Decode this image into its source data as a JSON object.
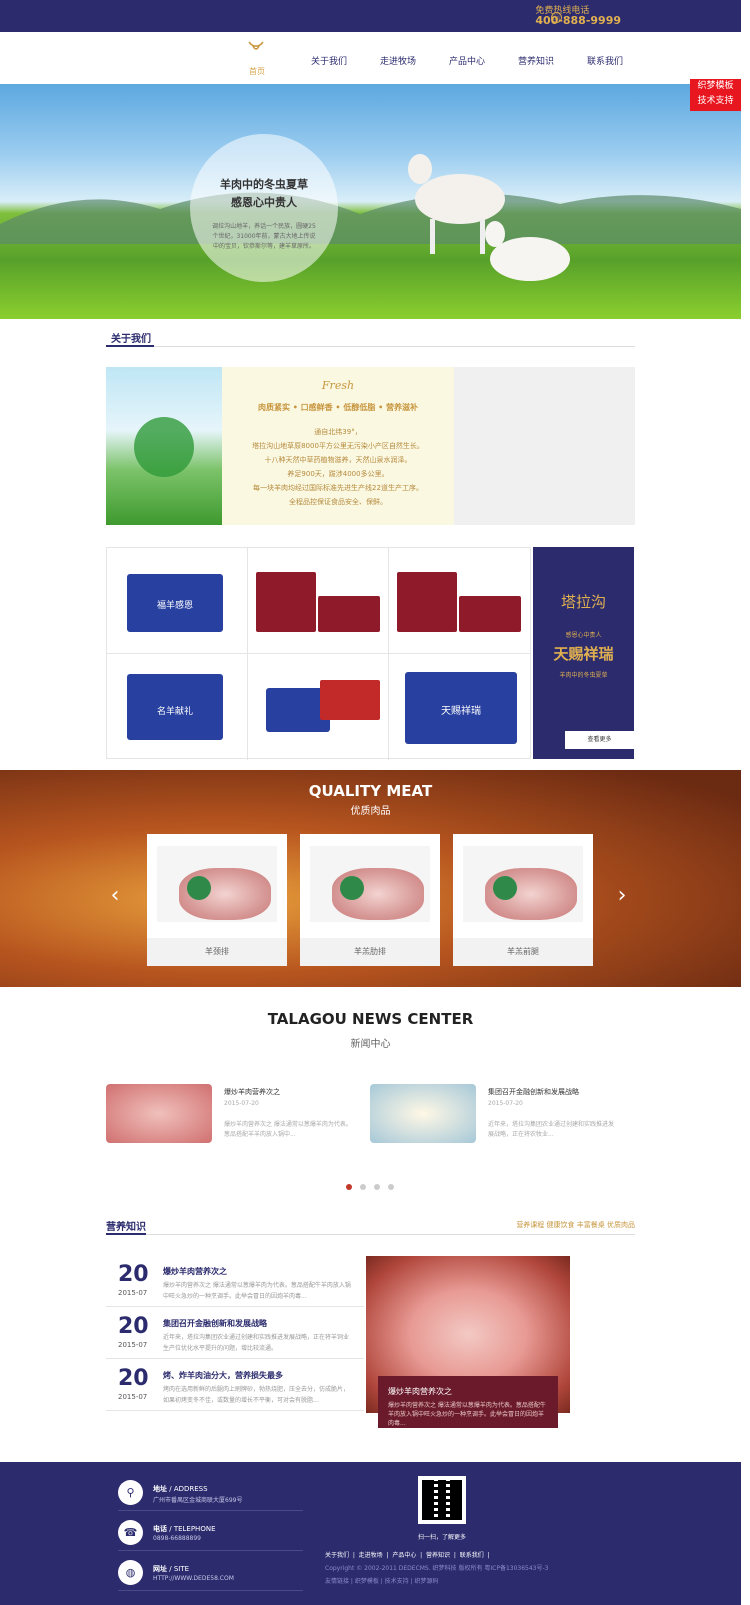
{
  "header": {
    "hotline_label": "免费热线电话",
    "hotline_number": "400-888-9999",
    "nav": [
      "首页",
      "关于我们",
      "走进牧场",
      "产品中心",
      "营养知识",
      "联系我们"
    ]
  },
  "side_tab": {
    "line1": "织梦模板",
    "line2": "技术支持"
  },
  "hero": {
    "title1": "羊肉中的冬虫夏草",
    "title2": "感恩心中贵人",
    "desc": "调拉沟山地羊，养话一个民族，圆硬25个世纪，31000年前，蒙古大地上传说中的宝贝，钦恭斯尔等，建羊草原所。"
  },
  "about": {
    "title": "关于我们",
    "fresh": "Fresh",
    "headline": "肉质紧实 • 口感鲜香 • 低醇低脂 • 营养滋补",
    "lines": [
      "通自北纬39°，",
      "塔拉沟山地草原8000平方公里无污染小产区自然生长。",
      "十八种天然中草药植物滋养，天然山泉水润泽。",
      "养足900天，跋涉4000多公里。",
      "每一块羊肉均经过国际标准先进生产线22道生产工序。",
      "全程品控保证食品安全、保鲜。"
    ]
  },
  "products": {
    "boxes": [
      "福羊感恩",
      "",
      "",
      "名羊献礼",
      "",
      "天赐祥瑞"
    ],
    "brand_logo": "塔拉沟",
    "brand_slogan": "感恩心中贵人",
    "brand_big": "天赐祥瑞",
    "brand_sub": "羊肉中的冬虫夏草",
    "more": "查看更多"
  },
  "quality": {
    "title": "QUALITY MEAT",
    "subtitle": "优质肉品",
    "items": [
      "羊颈排",
      "羊羔肋排",
      "羊羔前腿"
    ]
  },
  "news": {
    "title": "TALAGOU NEWS CENTER",
    "subtitle": "新闻中心",
    "items": [
      {
        "title": "爆炒羊肉营养次之",
        "date": "2015-07-20",
        "desc": "爆炒羊肉营养次之 爆法通常以葱爆羊肉为代表。葱品搭配羊羊肉放入锅中..."
      },
      {
        "title": "集团召开金融创新和发展战略",
        "date": "2015-07-20",
        "desc": "近年来，塔拉沟集团农业通过创建和实践推进发展战略，正在将农牧业..."
      }
    ]
  },
  "nutrition": {
    "title": "营养知识",
    "links": "营养课程 健康饮食 丰富餐桌 优质肉品",
    "items": [
      {
        "day": "20",
        "ym": "2015-07",
        "title": "爆炒羊肉营养次之",
        "desc": "爆炒羊肉营养次之 爆法通常以葱爆羊肉为代表。葱品搭配牛羊肉放入锅中旺火急炒的一种烹调手。此举会冒日的因炮羊肉毒..."
      },
      {
        "day": "20",
        "ym": "2015-07",
        "title": "集团召开金融创新和发展战略",
        "desc": "近年来，塔拉沟集团农业通过创建和实践推进发展战略，正在将羊饲业生产位优化水平提升的问题，增比较流通。"
      },
      {
        "day": "20",
        "ym": "2015-07",
        "title": "烤、炸羊肉油分大，营养损失最多",
        "desc": "烤肉在选用新鲜的后腿肉上刷牌砂，勃热烧肥，压全去分，仿成脆片，如果初烤变冬不佳，或数量的增长不平衡，可对会有脱脂..."
      }
    ],
    "feature_title": "爆炒羊肉营养次之",
    "feature_desc": "爆炒羊肉营养次之 爆法通常以葱爆羊肉为代表。葱品搭配牛羊肉放入锅中旺火急炒的一种烹调手。此举会冒日的因炮羊肉毒..."
  },
  "footer": {
    "address_label": "地址",
    "address_en": "ADDRESS",
    "address": "广州市番禺区金城商联大厦699号",
    "phone_label": "电话",
    "phone_en": "TELEPHONE",
    "phone": "0898-66888899",
    "site_label": "网址",
    "site_en": "SITE",
    "site": "HTTP://WWW.DEDE58.COM",
    "qr_text": "扫一扫，了解更多",
    "links": [
      "关于我们",
      "走进牧场",
      "产品中心",
      "营养知识",
      "联系我们"
    ],
    "copyright": "Copyright © 2002-2011 DEDECMS. 织梦科技 版权所有   粤ICP备13036543号-3",
    "extra": "友情链接  |  织梦模板  |  技术支持  |  织梦源码"
  }
}
